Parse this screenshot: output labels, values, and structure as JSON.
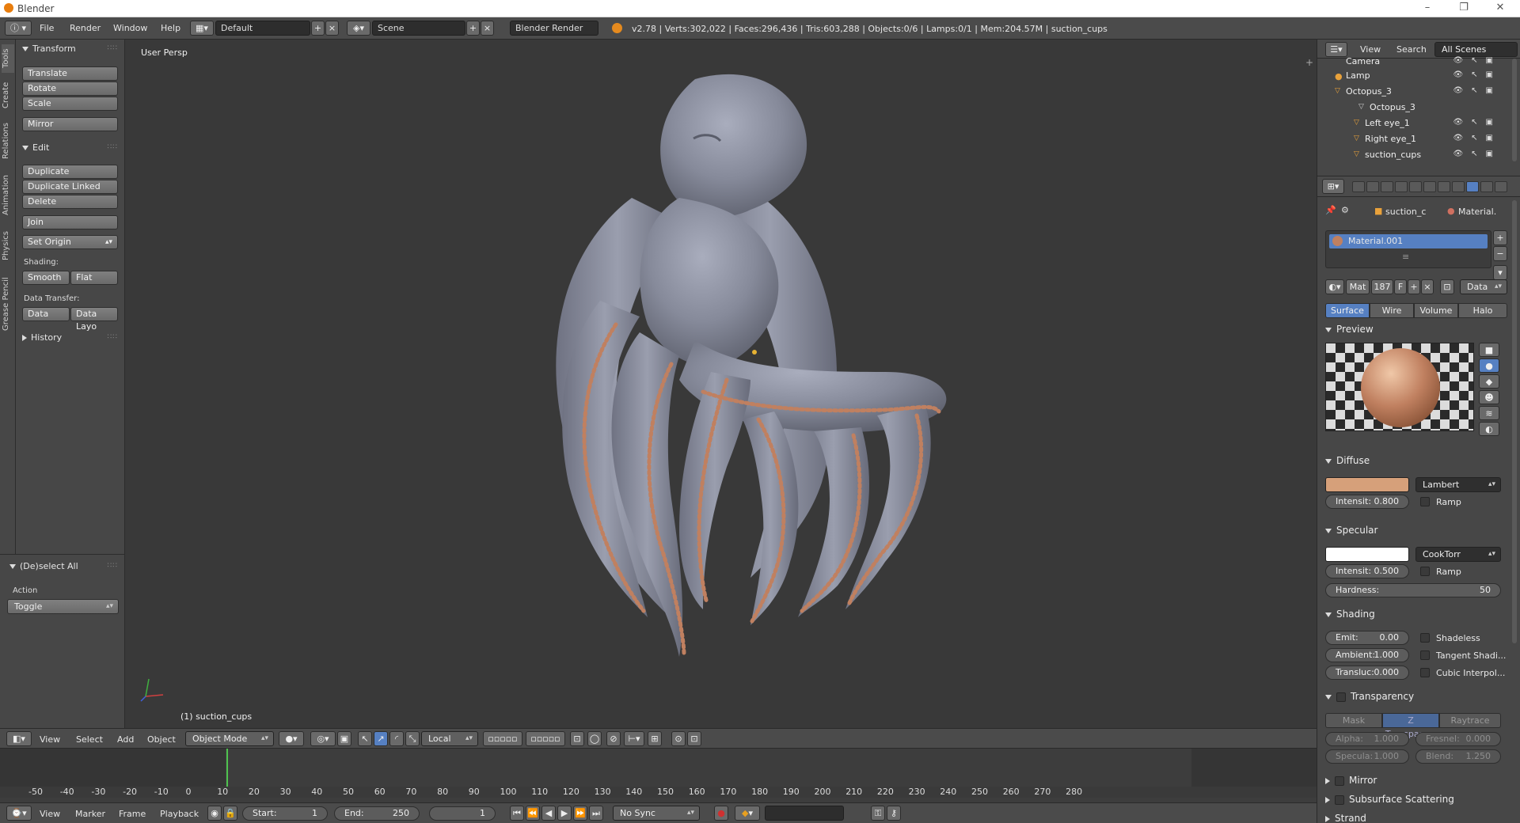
{
  "window": {
    "title": "Blender",
    "controls": [
      "–",
      "❐",
      "✕"
    ]
  },
  "info": {
    "menus": [
      "File",
      "Render",
      "Window",
      "Help"
    ],
    "layout": "Default",
    "scene": "Scene",
    "engine": "Blender Render",
    "stats": "v2.78 | Verts:302,022 | Faces:296,436 | Tris:603,288 | Objects:0/6 | Lamps:0/1 | Mem:204.57M | suction_cups"
  },
  "tool_tabs": [
    "Tools",
    "Create",
    "Relations",
    "Animation",
    "Physics",
    "Grease Pencil"
  ],
  "toolshelf": {
    "transform_header": "Transform",
    "translate": "Translate",
    "rotate": "Rotate",
    "scale": "Scale",
    "mirror": "Mirror",
    "edit_header": "Edit",
    "duplicate": "Duplicate",
    "duplicate_linked": "Duplicate Linked",
    "delete": "Delete",
    "join": "Join",
    "set_origin": "Set Origin",
    "shading_label": "Shading:",
    "smooth": "Smooth",
    "flat": "Flat",
    "data_transfer_label": "Data Transfer:",
    "data": "Data",
    "data_layo": "Data Layo",
    "history_header": "History",
    "operator_header": "(De)select All",
    "action_label": "Action",
    "action_value": "Toggle"
  },
  "viewport": {
    "persp_label": "User Persp",
    "object_label": "(1) suction_cups"
  },
  "view3d_header": {
    "menus": [
      "View",
      "Select",
      "Add",
      "Object"
    ],
    "mode": "Object Mode",
    "pivot": "Local"
  },
  "timeline": {
    "ticks": [
      "-50",
      "-40",
      "-30",
      "-20",
      "-10",
      "0",
      "10",
      "20",
      "30",
      "40",
      "50",
      "60",
      "70",
      "80",
      "90",
      "100",
      "110",
      "120",
      "130",
      "140",
      "150",
      "160",
      "170",
      "180",
      "190",
      "200",
      "210",
      "220",
      "230",
      "240",
      "250",
      "260",
      "270",
      "280"
    ],
    "menus": [
      "View",
      "Marker",
      "Frame",
      "Playback"
    ],
    "start_label": "Start:",
    "start_value": "1",
    "end_label": "End:",
    "end_value": "250",
    "current_frame": "1",
    "sync": "No Sync"
  },
  "outliner": {
    "view": "View",
    "search": "Search",
    "scenes": "All Scenes",
    "rows": [
      {
        "name": "Camera",
        "indent": 1
      },
      {
        "name": "Lamp",
        "indent": 1
      },
      {
        "name": "Octopus_3",
        "indent": 1
      },
      {
        "name": "Octopus_3",
        "indent": 3
      },
      {
        "name": "Left eye_1",
        "indent": 2
      },
      {
        "name": "Right eye_1",
        "indent": 2
      },
      {
        "name": "suction_cups",
        "indent": 2
      }
    ]
  },
  "properties": {
    "breadcrumb_object": "suction_c",
    "breadcrumb_material": "Material.",
    "material_slot": "Material.001",
    "mat_label": "Mat",
    "mat_users": "187",
    "mat_f": "F",
    "data_dropdown": "Data",
    "tabs": [
      "Surface",
      "Wire",
      "Volume",
      "Halo"
    ],
    "preview_header": "Preview",
    "diffuse_header": "Diffuse",
    "diffuse_color": "#d6a07a",
    "diffuse_shader": "Lambert",
    "diffuse_intensity_label": "Intensit:",
    "diffuse_intensity": "0.800",
    "ramp_label": "Ramp",
    "specular_header": "Specular",
    "specular_color": "#ffffff",
    "specular_shader": "CookTorr",
    "specular_intensity_label": "Intensit:",
    "specular_intensity": "0.500",
    "hardness_label": "Hardness:",
    "hardness": "50",
    "shading_header": "Shading",
    "emit_label": "Emit:",
    "emit": "0.00",
    "ambient_label": "Ambient:",
    "ambient": "1.000",
    "transluc_label": "Transluc:",
    "transluc": "0.000",
    "shadeless": "Shadeless",
    "tangent": "Tangent Shadi...",
    "cubic": "Cubic Interpol...",
    "transparency_header": "Transparency",
    "trans_tabs": [
      "Mask",
      "Z Transpare...",
      "Raytrace"
    ],
    "alpha_label": "Alpha:",
    "alpha": "1.000",
    "fresnel_label": "Fresnel:",
    "fresnel": "0.000",
    "specula_label": "Specula:",
    "specula": "1.000",
    "blend_label": "Blend:",
    "blend": "1.250",
    "mirror_header": "Mirror",
    "sss_header": "Subsurface Scattering",
    "strand_header": "Strand"
  },
  "colors": {
    "accent": "#5680c2",
    "octopus_skin": "#8a8e9e",
    "suction_cups": "#c08060"
  }
}
